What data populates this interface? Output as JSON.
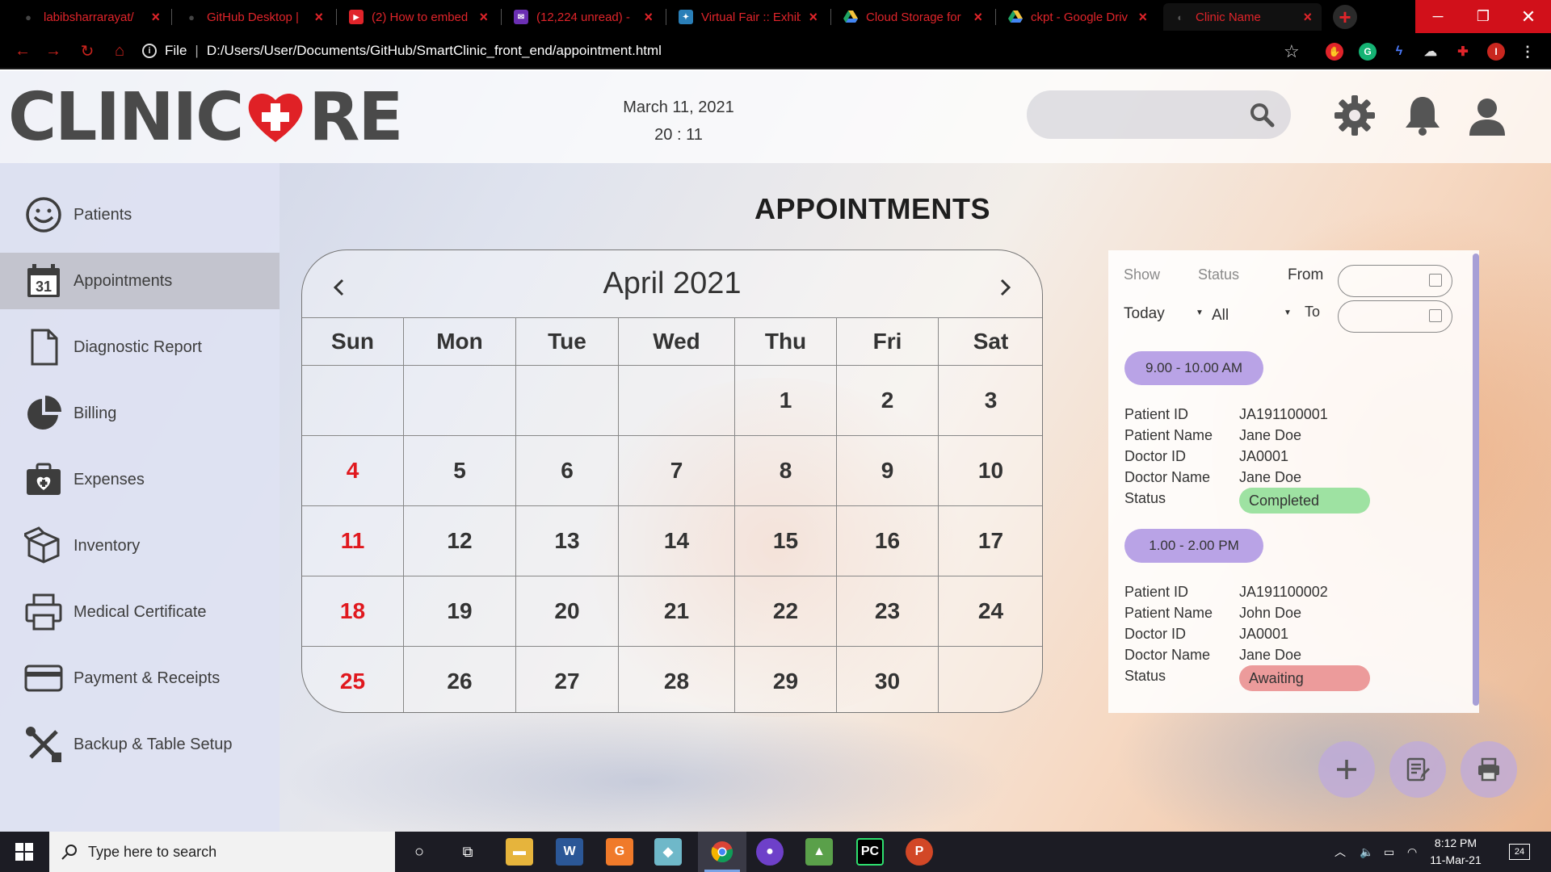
{
  "browser": {
    "tabs": [
      {
        "title": "labibsharrarayat/",
        "icon": "github-icon"
      },
      {
        "title": "GitHub Desktop | ",
        "icon": "github-icon"
      },
      {
        "title": "(2) How to embed",
        "icon": "youtube-icon"
      },
      {
        "title": "(12,224 unread) - ",
        "icon": "mail-icon"
      },
      {
        "title": "Virtual Fair :: Exhib",
        "icon": "fair-icon"
      },
      {
        "title": "Cloud Storage for ",
        "icon": "drive-icon"
      },
      {
        "title": "ckpt - Google Driv",
        "icon": "drive-icon"
      },
      {
        "title": "Clinic Name",
        "icon": "page-icon"
      }
    ],
    "address": {
      "scheme_label": "File",
      "path": "D:/Users/User/Documents/GitHub/SmartClinic_front_end/appointment.html"
    },
    "profile_initial": "I"
  },
  "header": {
    "logo_left": "CLINIC",
    "logo_right": "RE",
    "date": "March 11, 2021",
    "time": "20 : 11",
    "search_placeholder": ""
  },
  "sidebar": {
    "items": [
      {
        "label": "Patients",
        "icon": "smiley-icon",
        "active": false
      },
      {
        "label": "Appointments",
        "icon": "calendar-icon",
        "active": true,
        "icon_text": "31"
      },
      {
        "label": "Diagnostic Report",
        "icon": "document-icon",
        "active": false
      },
      {
        "label": "Billing",
        "icon": "pie-chart-icon",
        "active": false
      },
      {
        "label": "Expenses",
        "icon": "medkit-icon",
        "active": false
      },
      {
        "label": "Inventory",
        "icon": "box-icon",
        "active": false
      },
      {
        "label": "Medical Certificate",
        "icon": "printer-icon",
        "active": false
      },
      {
        "label": "Payment & Receipts",
        "icon": "card-icon",
        "active": false
      },
      {
        "label": "Backup & Table Setup",
        "icon": "tools-icon",
        "active": false
      }
    ]
  },
  "main": {
    "title": "APPOINTMENTS",
    "calendar": {
      "month_label": "April 2021",
      "weekdays": [
        "Sun",
        "Mon",
        "Tue",
        "Wed",
        "Thu",
        "Fri",
        "Sat"
      ],
      "weeks": [
        [
          "",
          "",
          "",
          "",
          "1",
          "2",
          "3"
        ],
        [
          "4",
          "5",
          "6",
          "7",
          "8",
          "9",
          "10"
        ],
        [
          "11",
          "12",
          "13",
          "14",
          "15",
          "16",
          "17"
        ],
        [
          "18",
          "19",
          "20",
          "21",
          "22",
          "23",
          "24"
        ],
        [
          "25",
          "26",
          "27",
          "28",
          "29",
          "30",
          ""
        ]
      ]
    },
    "filter": {
      "show_label": "Show",
      "status_label": "Status",
      "from_label": "From",
      "to_label": "To",
      "show_value": "Today",
      "status_value": "All",
      "from_value": "",
      "to_value": ""
    },
    "appointments": [
      {
        "time": "9.00 - 10.00 AM",
        "fields": [
          {
            "label": "Patient ID",
            "value": "JA191100001"
          },
          {
            "label": "Patient Name",
            "value": "Jane Doe"
          },
          {
            "label": "Doctor ID",
            "value": "JA0001"
          },
          {
            "label": "Doctor Name",
            "value": "Jane Doe"
          }
        ],
        "status_label": "Status",
        "status": "Completed",
        "status_color": "#9ee2a2"
      },
      {
        "time": "1.00 - 2.00 PM",
        "fields": [
          {
            "label": "Patient ID",
            "value": "JA191100002"
          },
          {
            "label": "Patient Name",
            "value": "John Doe"
          },
          {
            "label": "Doctor ID",
            "value": "JA0001"
          },
          {
            "label": "Doctor Name",
            "value": "Jane Doe"
          }
        ],
        "status_label": "Status",
        "status": "Awaiting",
        "status_color": "#ec9b9b"
      }
    ],
    "actions": [
      {
        "name": "add-appointment-button",
        "icon": "plus-icon"
      },
      {
        "name": "report-button",
        "icon": "clipboard-edit-icon"
      },
      {
        "name": "print-button",
        "icon": "printer-icon"
      }
    ]
  },
  "taskbar": {
    "search_placeholder": "Type here to search",
    "time": "8:12 PM",
    "date": "11-Mar-21",
    "notification_count": "24"
  },
  "colors": {
    "accent_purple": "#b9a3e6",
    "completed": "#9ee2a2",
    "awaiting": "#ec9b9b",
    "sunday_red": "#e0181e",
    "browser_red": "#e0242a"
  }
}
